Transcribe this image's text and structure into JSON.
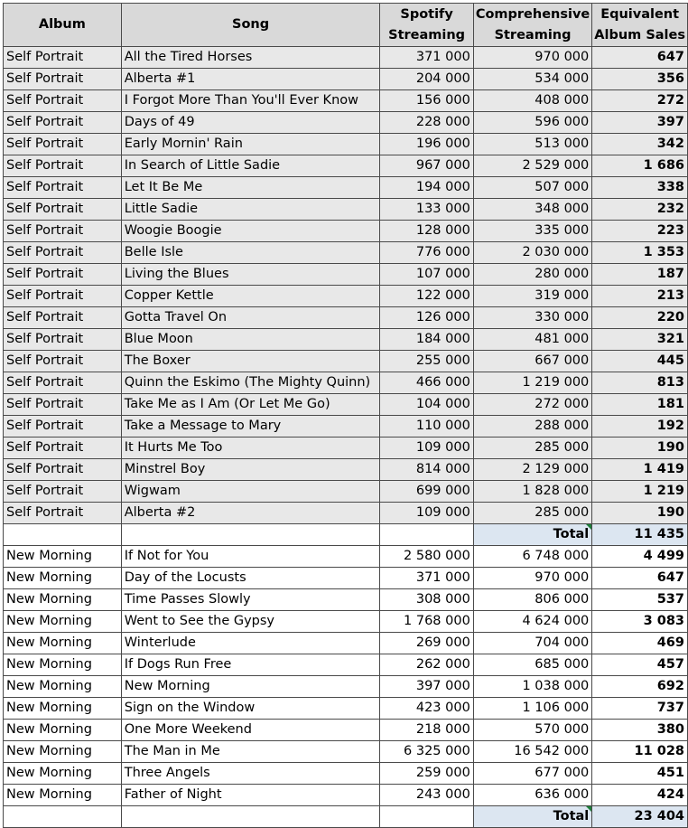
{
  "headers": {
    "album": "Album",
    "song": "Song",
    "spotify": [
      "Spotify",
      "Streaming"
    ],
    "comprehensive": [
      "Comprehensive",
      "Streaming"
    ],
    "eas": [
      "Equivalent",
      "Album Sales"
    ]
  },
  "self_portrait": {
    "rows": [
      {
        "album": "Self Portrait",
        "song": "All the Tired Horses",
        "spotify": "371 000",
        "comp": "970 000",
        "eas": "647"
      },
      {
        "album": "Self Portrait",
        "song": "Alberta #1",
        "spotify": "204 000",
        "comp": "534 000",
        "eas": "356"
      },
      {
        "album": "Self Portrait",
        "song": "I Forgot More Than You'll Ever Know",
        "spotify": "156 000",
        "comp": "408 000",
        "eas": "272"
      },
      {
        "album": "Self Portrait",
        "song": "Days of 49",
        "spotify": "228 000",
        "comp": "596 000",
        "eas": "397"
      },
      {
        "album": "Self Portrait",
        "song": "Early Mornin' Rain",
        "spotify": "196 000",
        "comp": "513 000",
        "eas": "342"
      },
      {
        "album": "Self Portrait",
        "song": "In Search of Little Sadie",
        "spotify": "967 000",
        "comp": "2 529 000",
        "eas": "1 686"
      },
      {
        "album": "Self Portrait",
        "song": "Let It Be Me",
        "spotify": "194 000",
        "comp": "507 000",
        "eas": "338"
      },
      {
        "album": "Self Portrait",
        "song": "Little Sadie",
        "spotify": "133 000",
        "comp": "348 000",
        "eas": "232"
      },
      {
        "album": "Self Portrait",
        "song": "Woogie Boogie",
        "spotify": "128 000",
        "comp": "335 000",
        "eas": "223"
      },
      {
        "album": "Self Portrait",
        "song": "Belle Isle",
        "spotify": "776 000",
        "comp": "2 030 000",
        "eas": "1 353"
      },
      {
        "album": "Self Portrait",
        "song": "Living the Blues",
        "spotify": "107 000",
        "comp": "280 000",
        "eas": "187"
      },
      {
        "album": "Self Portrait",
        "song": "Copper Kettle",
        "spotify": "122 000",
        "comp": "319 000",
        "eas": "213"
      },
      {
        "album": "Self Portrait",
        "song": "Gotta Travel On",
        "spotify": "126 000",
        "comp": "330 000",
        "eas": "220"
      },
      {
        "album": "Self Portrait",
        "song": "Blue Moon",
        "spotify": "184 000",
        "comp": "481 000",
        "eas": "321"
      },
      {
        "album": "Self Portrait",
        "song": "The Boxer",
        "spotify": "255 000",
        "comp": "667 000",
        "eas": "445"
      },
      {
        "album": "Self Portrait",
        "song": "Quinn the Eskimo (The Mighty Quinn)",
        "spotify": "466 000",
        "comp": "1 219 000",
        "eas": "813"
      },
      {
        "album": "Self Portrait",
        "song": "Take Me as I Am (Or Let Me Go)",
        "spotify": "104 000",
        "comp": "272 000",
        "eas": "181"
      },
      {
        "album": "Self Portrait",
        "song": "Take a Message to Mary",
        "spotify": "110 000",
        "comp": "288 000",
        "eas": "192"
      },
      {
        "album": "Self Portrait",
        "song": "It Hurts Me Too",
        "spotify": "109 000",
        "comp": "285 000",
        "eas": "190"
      },
      {
        "album": "Self Portrait",
        "song": "Minstrel Boy",
        "spotify": "814 000",
        "comp": "2 129 000",
        "eas": "1 419"
      },
      {
        "album": "Self Portrait",
        "song": "Wigwam",
        "spotify": "699 000",
        "comp": "1 828 000",
        "eas": "1 219"
      },
      {
        "album": "Self Portrait",
        "song": "Alberta #2",
        "spotify": "109 000",
        "comp": "285 000",
        "eas": "190"
      }
    ],
    "total_label": "Total",
    "total_value": "11 435"
  },
  "new_morning": {
    "rows": [
      {
        "album": "New Morning",
        "song": "If Not for You",
        "spotify": "2 580 000",
        "comp": "6 748 000",
        "eas": "4 499"
      },
      {
        "album": "New Morning",
        "song": "Day of the Locusts",
        "spotify": "371 000",
        "comp": "970 000",
        "eas": "647"
      },
      {
        "album": "New Morning",
        "song": "Time Passes Slowly",
        "spotify": "308 000",
        "comp": "806 000",
        "eas": "537"
      },
      {
        "album": "New Morning",
        "song": "Went to See the Gypsy",
        "spotify": "1 768 000",
        "comp": "4 624 000",
        "eas": "3 083"
      },
      {
        "album": "New Morning",
        "song": "Winterlude",
        "spotify": "269 000",
        "comp": "704 000",
        "eas": "469"
      },
      {
        "album": "New Morning",
        "song": "If Dogs Run Free",
        "spotify": "262 000",
        "comp": "685 000",
        "eas": "457"
      },
      {
        "album": "New Morning",
        "song": "New Morning",
        "spotify": "397 000",
        "comp": "1 038 000",
        "eas": "692"
      },
      {
        "album": "New Morning",
        "song": "Sign on the Window",
        "spotify": "423 000",
        "comp": "1 106 000",
        "eas": "737"
      },
      {
        "album": "New Morning",
        "song": "One More Weekend",
        "spotify": "218 000",
        "comp": "570 000",
        "eas": "380"
      },
      {
        "album": "New Morning",
        "song": "The Man in Me",
        "spotify": "6 325 000",
        "comp": "16 542 000",
        "eas": "11 028"
      },
      {
        "album": "New Morning",
        "song": "Three Angels",
        "spotify": "259 000",
        "comp": "677 000",
        "eas": "451"
      },
      {
        "album": "New Morning",
        "song": "Father of Night",
        "spotify": "243 000",
        "comp": "636 000",
        "eas": "424"
      }
    ],
    "total_label": "Total",
    "total_value": "23 404"
  }
}
